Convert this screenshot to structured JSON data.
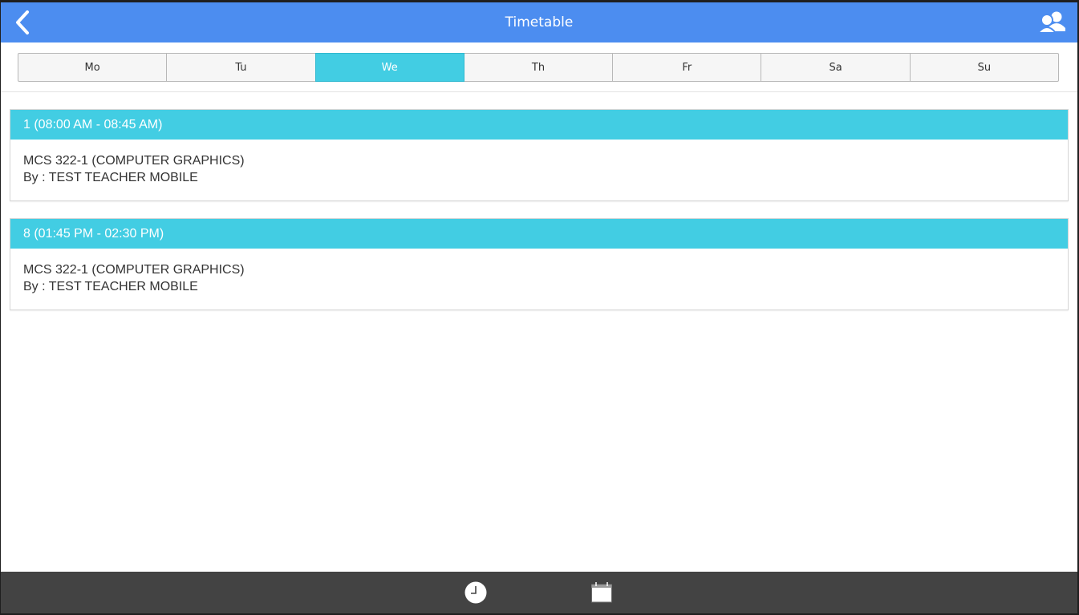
{
  "header": {
    "title": "Timetable",
    "back_icon": "chevron-left-icon",
    "profile_icon": "users-icon"
  },
  "days": [
    {
      "label": "Mo",
      "active": false
    },
    {
      "label": "Tu",
      "active": false
    },
    {
      "label": "We",
      "active": true
    },
    {
      "label": "Th",
      "active": false
    },
    {
      "label": "Fr",
      "active": false
    },
    {
      "label": "Sa",
      "active": false
    },
    {
      "label": "Su",
      "active": false
    }
  ],
  "periods": [
    {
      "header": "1 (08:00 AM - 08:45 AM)",
      "subject": "MCS 322-1 (COMPUTER GRAPHICS)",
      "teacher": "By : TEST TEACHER MOBILE"
    },
    {
      "header": "8 (01:45 PM - 02:30 PM)",
      "subject": "MCS 322-1 (COMPUTER GRAPHICS)",
      "teacher": "By : TEST TEACHER MOBILE"
    }
  ],
  "footer": {
    "left_icon": "clock-icon",
    "right_icon": "calendar-icon"
  },
  "colors": {
    "header_bg": "#4c8df0",
    "accent": "#42cde3",
    "footer_bg": "#434343"
  }
}
